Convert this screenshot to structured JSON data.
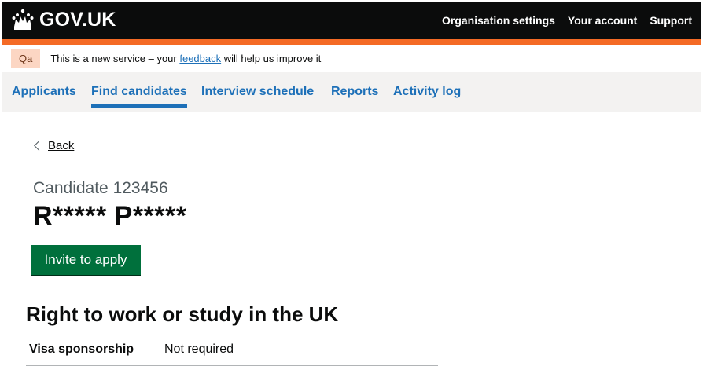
{
  "header": {
    "logo_text": "GOV.UK",
    "nav": [
      "Organisation settings",
      "Your account",
      "Support"
    ]
  },
  "phase_banner": {
    "tag": "Qa",
    "text_before": "This is a new service – your ",
    "link": "feedback",
    "text_after": " will help us improve it"
  },
  "subnav": {
    "items": [
      "Applicants",
      "Find candidates",
      "Interview schedule",
      "Reports",
      "Activity log"
    ],
    "active": "Find candidates"
  },
  "page": {
    "back_label": "Back",
    "caption": "Candidate 123456",
    "candidate_name": "R***** P*****",
    "invite_button": "Invite to apply",
    "section_heading": "Right to work or study in the UK",
    "summary": [
      {
        "key": "Visa sponsorship",
        "value": "Not required"
      }
    ]
  },
  "colors": {
    "header_bg": "#0b0c0c",
    "stripe": "#f46a25",
    "link": "#1d70b8",
    "button": "#00703c",
    "tag_bg": "#fcd6c3"
  }
}
